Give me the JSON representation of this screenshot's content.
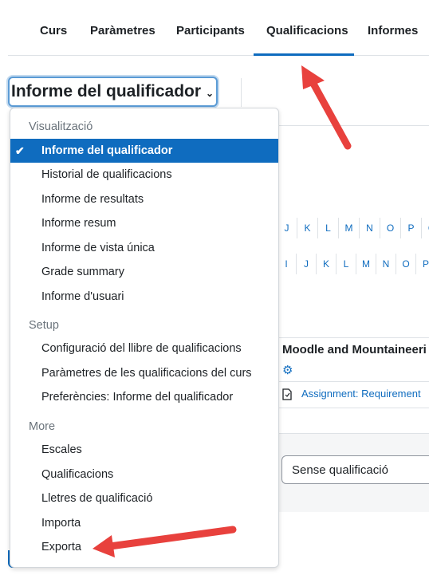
{
  "nav": {
    "tabs": [
      "Curs",
      "Paràmetres",
      "Participants",
      "Qualificacions",
      "Informes"
    ],
    "active_tab": "Qualificacions"
  },
  "report_select": {
    "selected": "Informe del qualificador",
    "chevron_icon": "chevron-down-icon"
  },
  "menu": {
    "groups": [
      {
        "header": "Visualització",
        "items": [
          "Informe del qualificador",
          "Historial de qualificacions",
          "Informe de resultats",
          "Informe resum",
          "Informe de vista única",
          "Grade summary",
          "Informe d'usuari"
        ]
      },
      {
        "header": "Setup",
        "items": [
          "Configuració del llibre de qualificacions",
          "Paràmetres de les qualificacions del curs",
          "Preferències: Informe del qualificador"
        ]
      },
      {
        "header": "More",
        "items": [
          "Escales",
          "Qualificacions",
          "Lletres de qualificació",
          "Importa",
          "Exporta"
        ]
      }
    ],
    "check_mark": "✔"
  },
  "background": {
    "letters_row1": [
      "J",
      "K",
      "L",
      "M",
      "N",
      "O",
      "P",
      "Q"
    ],
    "letters_row2": [
      "I",
      "J",
      "K",
      "L",
      "M",
      "N",
      "O",
      "P"
    ],
    "course_title": "Moodle and Mountaineeri",
    "assignment_link": "Assignment: Requirement",
    "grade_select_value": "Sense qualificació"
  },
  "colors": {
    "accent": "#0f6cbf",
    "arrow": "#e8413d"
  }
}
